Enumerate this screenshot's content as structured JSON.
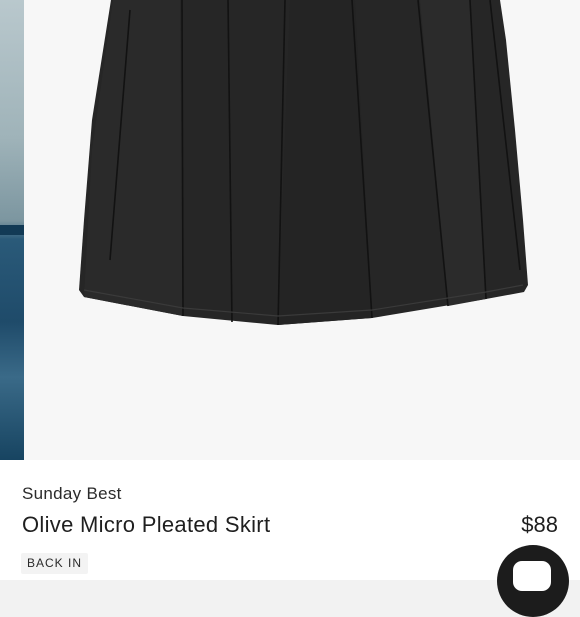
{
  "product": {
    "brand": "Sunday Best",
    "title": "Olive Micro Pleated Skirt",
    "price": "$88",
    "badge": "BACK IN"
  },
  "icons": {
    "chat_button": "chat-bubble-icon"
  },
  "colors": {
    "skirt": "#262626",
    "background": "#f7f7f7",
    "chat_button": "#1c1c1c"
  }
}
